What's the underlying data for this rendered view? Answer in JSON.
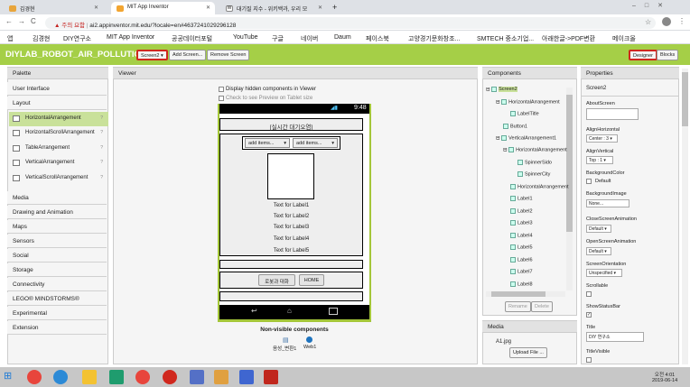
{
  "browser": {
    "tabs": [
      {
        "label": "김경현",
        "color": "#e8a53c"
      },
      {
        "label": "MIT App Inventor",
        "color": "#f2a531"
      },
      {
        "label": "대기질 지수 - 위키백과, 우리 모",
        "color": "#888"
      }
    ],
    "new_tab": "+",
    "url_warning": "주의 요함",
    "url": "ai2.appinventor.mit.edu/?locale=en#4637241029296128",
    "bookmarks": [
      "앱",
      "김경현",
      "DIY연구소",
      "MIT App Inventor",
      "공공데이터포털",
      "YouTube",
      "구글",
      "네이버",
      "Daum",
      "페이스북",
      "고양경기문화창조...",
      "SMTECH 중소기업...",
      "아래한글->PDF변환",
      "메이크올"
    ]
  },
  "app": {
    "project_title": "DIYLAB_ROBOT_AIR_POLLUTION2",
    "screen_select": "Screen2 ▾",
    "add_screen": "Add Screen...",
    "remove_screen": "Remove Screen",
    "designer": "Designer",
    "blocks": "Blocks"
  },
  "palette": {
    "title": "Palette",
    "categories_top": [
      "User Interface",
      "Layout"
    ],
    "layout_items": [
      "HorizontalArrangement",
      "HorizontalScrollArrangement",
      "TableArrangement",
      "VerticalArrangement",
      "VerticalScrollArrangement"
    ],
    "categories_bottom": [
      "Media",
      "Drawing and Animation",
      "Maps",
      "Sensors",
      "Social",
      "Storage",
      "Connectivity",
      "LEGO® MINDSTORMS®",
      "Experimental",
      "Extension"
    ]
  },
  "viewer": {
    "title": "Viewer",
    "hidden_components": "Display hidden components in Viewer",
    "tablet_preview": "Check to see Preview on Tablet size",
    "time": "9:48",
    "title_label": "[실시간 대기오염]",
    "spinner1": "add items...",
    "spinner2": "add items...",
    "labels": [
      "Text for Label1",
      "Text for Label2",
      "Text for Label3",
      "Text for Label4",
      "Text for Label5"
    ],
    "btn_robot": "로봇과 대화",
    "btn_home": "HOME",
    "nonvisible_title": "Non-visible components",
    "nonvisible": [
      "음성_변환1",
      "Web1"
    ]
  },
  "components": {
    "title": "Components",
    "tree": [
      "Screen2",
      "HorizontalArrangement",
      "LabelTitle",
      "Button1",
      "VerticalArrangement1",
      "HorizontalArrangement",
      "SpinnerSido",
      "SpinnerCity",
      "HorizontalArrangement",
      "Label1",
      "Label2",
      "Label3",
      "Label4",
      "Label5",
      "Label6",
      "Label7",
      "Label8"
    ],
    "rename": "Rename",
    "delete": "Delete"
  },
  "media": {
    "title": "Media",
    "file": "A1.jpg",
    "upload": "Upload File ..."
  },
  "properties": {
    "title": "Properties",
    "component": "Screen2",
    "about_screen": "AboutScreen",
    "align_h": "AlignHorizontal",
    "align_h_val": "Center : 3 ▾",
    "align_v": "AlignVertical",
    "align_v_val": "Top : 1 ▾",
    "bg_color": "BackgroundColor",
    "bg_color_val": "Default",
    "bg_image": "BackgroundImage",
    "bg_image_val": "None...",
    "close_anim": "CloseScreenAnimation",
    "close_anim_val": "Default ▾",
    "open_anim": "OpenScreenAnimation",
    "open_anim_val": "Default ▾",
    "orientation": "ScreenOrientation",
    "orientation_val": "Unspecified ▾",
    "scrollable": "Scrollable",
    "show_status": "ShowStatusBar",
    "title_prop": "Title",
    "title_val": "DIY 연구소",
    "title_visible": "TitleVisible"
  },
  "taskbar": {
    "time": "오전 4:01",
    "date": "2019-06-14"
  }
}
